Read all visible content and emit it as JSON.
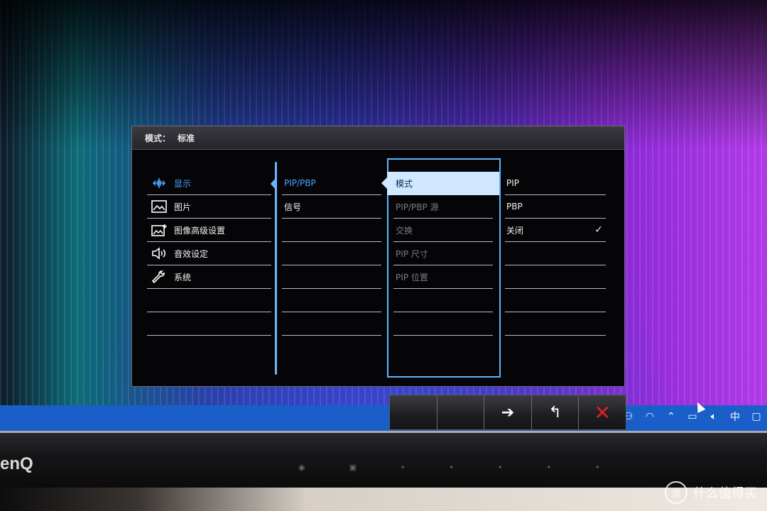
{
  "osd": {
    "header": {
      "mode_label": "模式：",
      "mode_value": "标准"
    },
    "main_menu": [
      {
        "label": "显示",
        "icon": "display-icon",
        "active": true
      },
      {
        "label": "图片",
        "icon": "picture-icon",
        "active": false
      },
      {
        "label": "图像高级设置",
        "icon": "picture-advanced-icon",
        "active": false
      },
      {
        "label": "音效设定",
        "icon": "speaker-icon",
        "active": false
      },
      {
        "label": "系统",
        "icon": "wrench-icon",
        "active": false
      },
      {
        "label": "",
        "icon": "",
        "active": false
      },
      {
        "label": "",
        "icon": "",
        "active": false
      }
    ],
    "sub_menu": [
      {
        "label": "PIP/PBP",
        "active": true
      },
      {
        "label": "信号",
        "active": false
      },
      {
        "label": ""
      },
      {
        "label": ""
      },
      {
        "label": ""
      },
      {
        "label": ""
      },
      {
        "label": ""
      }
    ],
    "options_menu": [
      {
        "label": "模式",
        "active": true
      },
      {
        "label": "PIP/PBP 源",
        "active": false
      },
      {
        "label": "交换",
        "active": false
      },
      {
        "label": "PIP 尺寸",
        "active": false
      },
      {
        "label": "PIP 位置",
        "active": false
      },
      {
        "label": ""
      },
      {
        "label": ""
      }
    ],
    "values_menu": [
      {
        "label": "PIP",
        "selected": false
      },
      {
        "label": "PBP",
        "selected": false
      },
      {
        "label": "关闭",
        "selected": true
      },
      {
        "label": ""
      },
      {
        "label": ""
      },
      {
        "label": ""
      },
      {
        "label": ""
      }
    ],
    "checkmark": "✓"
  },
  "hotkeys": [
    {
      "name": "blank-key-1",
      "glyph": ""
    },
    {
      "name": "blank-key-2",
      "glyph": ""
    },
    {
      "name": "enter-arrow-icon",
      "glyph": "➔"
    },
    {
      "name": "back-icon",
      "glyph": "↰"
    },
    {
      "name": "close-icon",
      "glyph": "✕"
    }
  ],
  "taskbar": {
    "tray_ime": "中"
  },
  "bezel": {
    "brand": "enQ"
  },
  "watermark": {
    "logo": "值",
    "text": "什么值得买"
  },
  "colors": {
    "accent": "#4aa3ff",
    "frame": "#59b6ff",
    "taskbar": "#1a5fc9",
    "close": "#e02020"
  }
}
